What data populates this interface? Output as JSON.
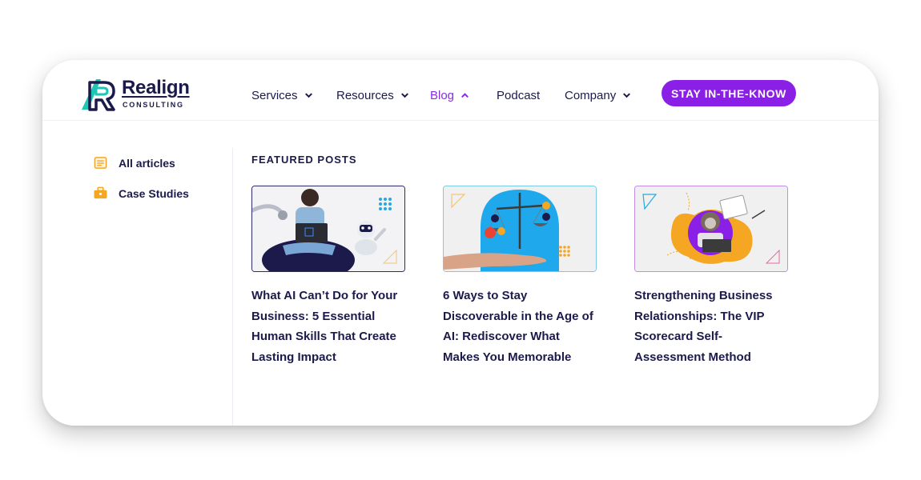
{
  "brand": {
    "name": "Realign",
    "subtitle": "CONSULTING",
    "accent": "#8a20e6",
    "navy": "#1b1a4a",
    "teal": "#1ec6b4"
  },
  "nav": {
    "services": "Services",
    "resources": "Resources",
    "blog": "Blog",
    "podcast": "Podcast",
    "company": "Company",
    "cta": "STAY IN-THE-KNOW"
  },
  "sidebar": {
    "items": [
      {
        "label": "All articles",
        "icon": "document-list-icon"
      },
      {
        "label": "Case Studies",
        "icon": "briefcase-icon"
      }
    ]
  },
  "featured": {
    "heading": "FEATURED POSTS",
    "posts": [
      {
        "title": "What AI Can’t Do for Your Business: 5 Essential Human Skills That Create Lasting Impact",
        "image": "woman-with-laptop-and-robots"
      },
      {
        "title": "6 Ways to Stay Discoverable in the Age of AI: Rediscover What Makes You Memorable",
        "image": "balance-scale-on-hand"
      },
      {
        "title": "Strengthening Business Relationships: The VIP Scorecard Self-Assessment Method",
        "image": "woman-at-laptop-with-calendar"
      }
    ]
  }
}
